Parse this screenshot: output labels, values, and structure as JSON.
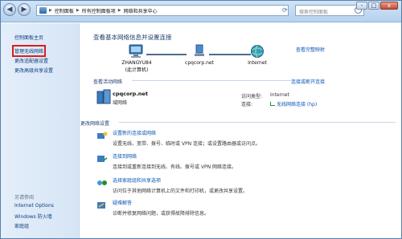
{
  "titlebar": {
    "breadcrumbs": [
      "控制面板",
      "所有控制面板项",
      "网络和共享中心"
    ],
    "search_placeholder": "搜索控制面板",
    "buttons": [
      "-",
      "□",
      "x"
    ]
  },
  "sidebar": {
    "items": [
      "控制面板主页",
      "管理无线网络",
      "更改适配器设置",
      "更改高级共享设置"
    ],
    "see_also_title": "另请参阅",
    "see_also": [
      "Internet Options",
      "Windows 防火墙",
      "家庭组"
    ]
  },
  "main": {
    "title": "查看基本网络信息并设置连接",
    "full_map_link": "查看完整映射",
    "nodes": [
      {
        "name": "ZHANGYU84",
        "sub": "(此计算机)"
      },
      {
        "name": "cpqcorp.net",
        "sub": ""
      },
      {
        "name": "Internet",
        "sub": ""
      }
    ],
    "active_title": "查看活动网络",
    "connect_link": "连接或断开连接",
    "network_name": "cpqcorp.net",
    "network_type": "域网络",
    "access_label": "访问类型:",
    "access_value": "Internet",
    "conn_label": "连接:",
    "conn_value": "无线网络连接 (hp)",
    "change_title": "更改网络设置",
    "tasks": [
      {
        "title": "设置新的连接或网络",
        "desc": "设置无线、宽带、拨号、临时或 VPN 连接；或设置路由器或访问点。"
      },
      {
        "title": "连接到网络",
        "desc": "连接到或重新连接到无线、有线、拨号或 VPN 网络连接。"
      },
      {
        "title": "选择家庭组和共享选项",
        "desc": "访问位于其他网络计算机上的文件和打印机，或更改共享设置。"
      },
      {
        "title": "疑难解答",
        "desc": "诊断并修复网络问题，或获得故障排除信息。"
      }
    ]
  },
  "colors": {
    "link": "#0b57b6",
    "heading": "#1e3e6e",
    "highlight": "#e01b1b"
  }
}
